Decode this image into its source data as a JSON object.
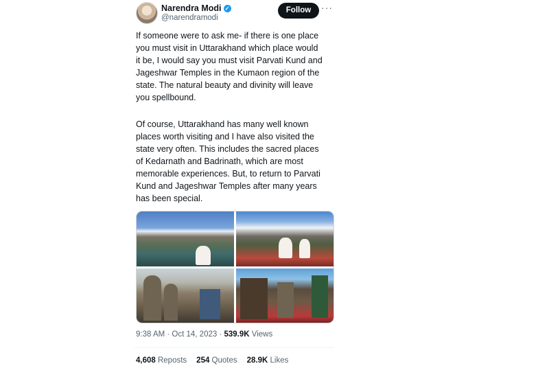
{
  "author": {
    "name": "Narendra Modi",
    "handle": "@narendramodi",
    "verified_icon": "✓"
  },
  "actions": {
    "follow_label": "Follow",
    "more_label": "···"
  },
  "tweet": {
    "paragraph1": [
      "If someone were to ask me- if there is one place",
      "you must visit in Uttarakhand which place would",
      "it be, I would say you must visit Parvati Kund and",
      "Jageshwar Temples in the Kumaon region of the",
      "state. The natural beauty and divinity will leave",
      "you spellbound."
    ],
    "paragraph2": [
      "Of course, Uttarakhand has many well known",
      "places worth visiting and I have also visited the",
      "state very often. This includes the sacred places",
      "of Kedarnath and Badrinath, which are most",
      "memorable experiences. But, to return to Parvati",
      "Kund and Jageshwar Temples after many years",
      "has been special."
    ]
  },
  "meta": {
    "timestamp": "9:38 AM · Oct 14, 2023 · ",
    "views_count": "539.9K",
    "views_label": " Views"
  },
  "stats": {
    "reposts_count": "4,608",
    "reposts_label": " Reposts",
    "quotes_count": "254",
    "quotes_label": " Quotes",
    "likes_count": "28.9K",
    "likes_label": " Likes"
  },
  "colors": {
    "text": "#0f1419",
    "secondary": "#536471",
    "verified": "#1d9bf0",
    "follow_bg": "#0f1419"
  }
}
